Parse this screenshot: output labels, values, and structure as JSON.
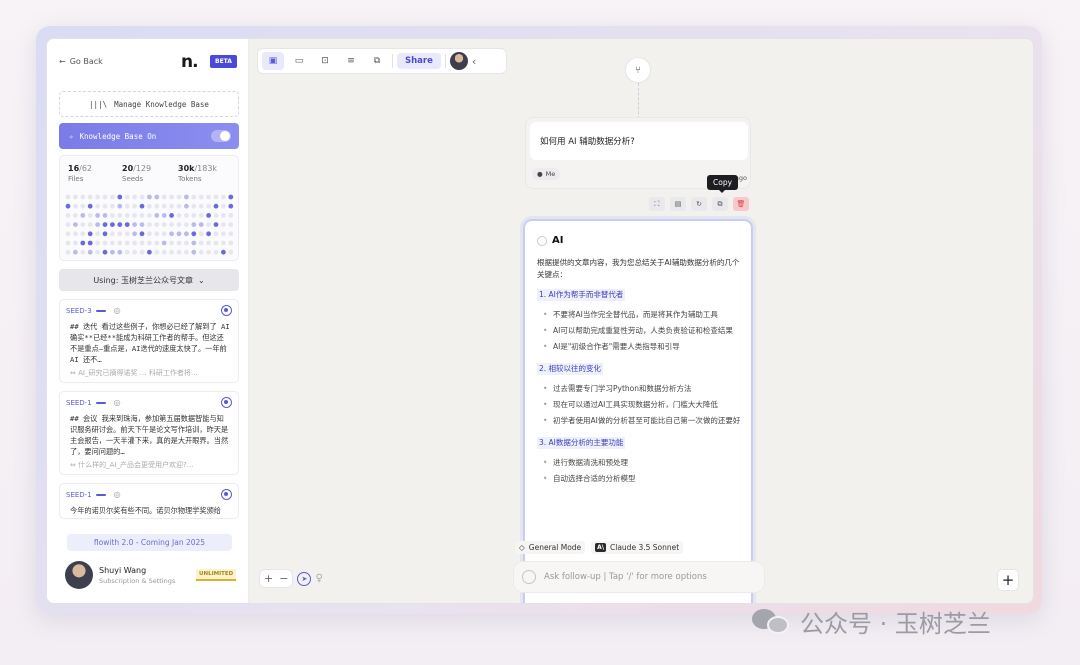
{
  "sidebar": {
    "go_back": "Go Back",
    "logo": "n.",
    "beta": "BETA",
    "manage_kb": "Manage Knowledge Base",
    "kb_on": "Knowledge Base On",
    "stats": [
      {
        "value": "16",
        "total": "/62",
        "label": "Files"
      },
      {
        "value": "20",
        "total": "/129",
        "label": "Seeds"
      },
      {
        "value": "30k",
        "total": "/183k",
        "label": "Tokens"
      }
    ],
    "using": "Using: 玉树芝兰公众号文章",
    "seeds": [
      {
        "tag": "SEED-3",
        "body": "## 迭代 看过这些例子，你想必已经了解到了 AI 确实**已经**能成为科研工作者的帮手。但这还不是重点—重点是，AI迭代的速度太快了。一年前 AI 还不…",
        "source": "AI_研究已摘得诺奖 … 科研工作者将…"
      },
      {
        "tag": "SEED-1",
        "body": "## 会议 我来到珠海，参加第五届数据智能与知识服务研讨会。前天下午是论文写作培训，昨天是主会报告，一天半灌下来，真的是大开眼界。当然了，要问问题的…",
        "source": "什么样的_AI_产品会更受用户欢迎?…"
      },
      {
        "tag": "SEED-1",
        "body": "今年的诺贝尔奖有些不同。诺贝尔物理学奖颁给了…",
        "source": ""
      }
    ],
    "flowith": "flowith 2.0 - Coming Jan 2025",
    "user_name": "Shuyi Wang",
    "user_sub": "Subscription & Settings",
    "unlimited": "UNLIMITED"
  },
  "toolbar": {
    "share": "Share",
    "icons": [
      "sidebar-toggle-icon",
      "chat-icon",
      "present-icon",
      "list-icon",
      "copy-icon"
    ]
  },
  "canvas": {
    "question": "如何用 AI 辅助数据分析?",
    "me": "Me",
    "ago": "ago",
    "copy_tooltip": "Copy",
    "ai_title": "AI",
    "ai_intro": "根据提供的文章内容，我为您总结关于AI辅助数据分析的几个关键点：",
    "sections": [
      {
        "title": "1. AI作为帮手而非替代者",
        "items": [
          "不要将AI当作完全替代品，而是将其作为辅助工具",
          "AI可以帮助完成重复性劳动，人类负责验证和检查结果",
          "AI是\"初级合作者\"需要人类指导和引导"
        ]
      },
      {
        "title": "2. 相较以往的变化",
        "items": [
          "过去需要专门学习Python和数据分析方法",
          "现在可以通过AI工具实现数据分析，门槛大大降低",
          "初学者使用AI做的分析甚至可能比自己第一次做的还要好"
        ]
      },
      {
        "title": "3. AI数据分析的主要功能",
        "items": [
          "进行数据清洗和预处理",
          "自动选择合适的分析模型"
        ]
      }
    ],
    "mode": "General Mode",
    "model_badge": "A\\",
    "model": "Claude 3.5 Sonnet",
    "followup_placeholder": "Ask follow-up | Tap '/' for more options"
  },
  "watermark": "公众号 · 玉树芝兰",
  "colors": {
    "accent": "#5a5ad8",
    "kb_on_bg": "#7b7be8",
    "beta_bg": "#4b4ad6",
    "delete": "#f7c8cc"
  }
}
